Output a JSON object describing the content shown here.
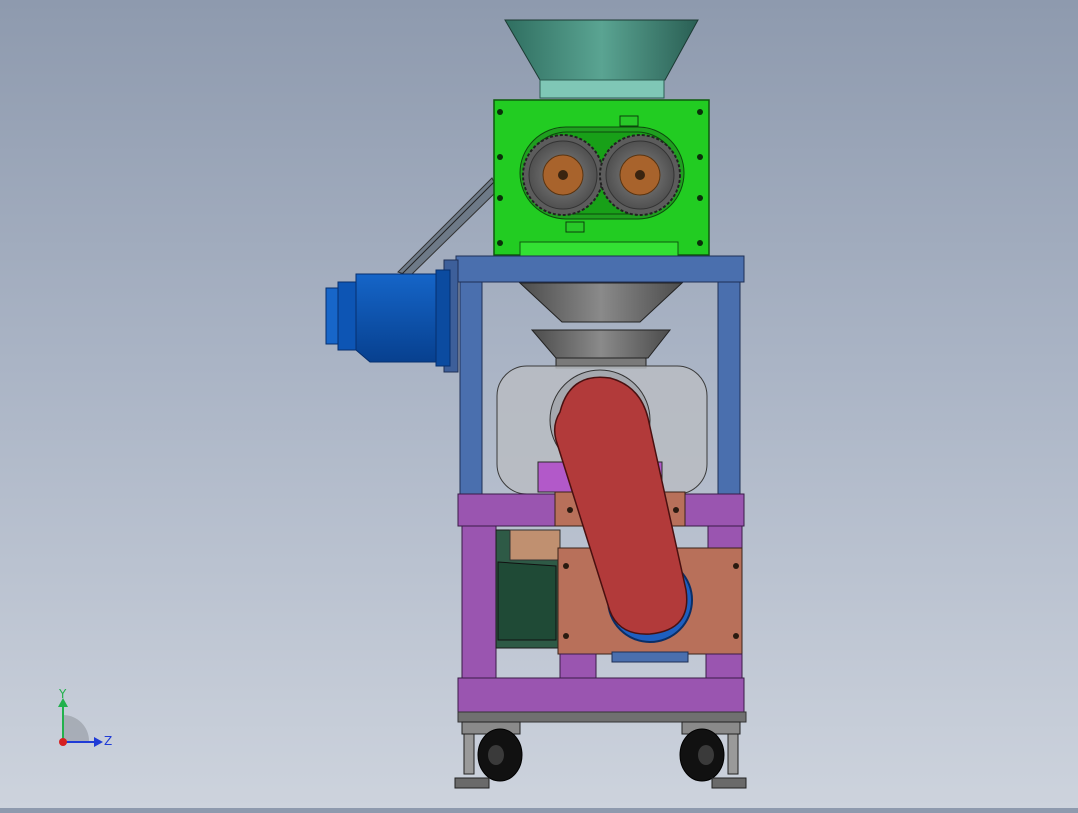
{
  "viewport": {
    "background_top": "#8e9aae",
    "background_bottom": "#cdd3dd"
  },
  "triad": {
    "y_label": "Y",
    "z_label": "Z",
    "y_color": "#22b14c",
    "z_color": "#1f3bd6",
    "x_color": "#d62020"
  },
  "model": {
    "hopper_color": "#4a8a7a",
    "gearbox_color": "#22cc22",
    "motor_color": "#0b52b0",
    "upper_frame_color": "#4a6fae",
    "lower_frame_color": "#9a55b0",
    "belt_guard_color": "#b23a3a",
    "mount_plate_color": "#b8705a",
    "roller_color": "#8a5a35"
  }
}
